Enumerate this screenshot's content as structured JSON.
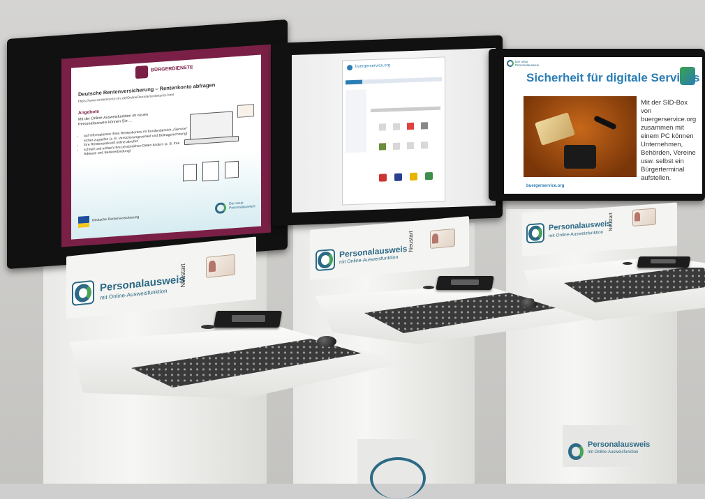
{
  "left_screen": {
    "header": "BÜRGERDIENSTE",
    "title": "Deutsche Rentenversicherung – Rentenkonto abfragen",
    "url": "https://www.rentenkonto-drv.de/OnlineDienste/rentekonto.html",
    "section": "Angebote",
    "intro": "Mit der Online-Ausweisfunktion im neuen Personalausweis können Sie ...",
    "bullets": [
      "auf Informationen Ihres Rentenkontos im Kundenbereich „rService“ sicher zugreifen (z. B. Versicherungsverlauf und Beitragsrechnung)",
      "Ihre Rentenauskunft online abrufen",
      "schnell und einfach Ihre persönlichen Daten ändern (z. B. Ihre Adresse und Bankverbindung)"
    ],
    "footer_org": "Deutsche Rentenversicherung",
    "footer_logo": "Der neue Personalausweis"
  },
  "middle_screen": {
    "site_title": "buergerservice.org"
  },
  "right_screen": {
    "logo_small": "Der neue Personalausweis",
    "headline": "Sicherheit für digitale Services",
    "body": "Mit der SID-Box von buergerservice.org zusammen mit einem PC können Unternehmen, Behörden, Vereine usw. selbst ein Bürgerterminal aufstellen.",
    "footer": "buergerservice.org"
  },
  "kiosk": {
    "brand": "Personalausweis",
    "brand_sub": "mit Online-Ausweisfunktion",
    "restart_label": "Neustart"
  },
  "colors": {
    "brand_blue": "#2d6a86",
    "brand_green": "#4aa35a",
    "burgundy": "#7a2046",
    "right_headline": "#2a7db4"
  }
}
